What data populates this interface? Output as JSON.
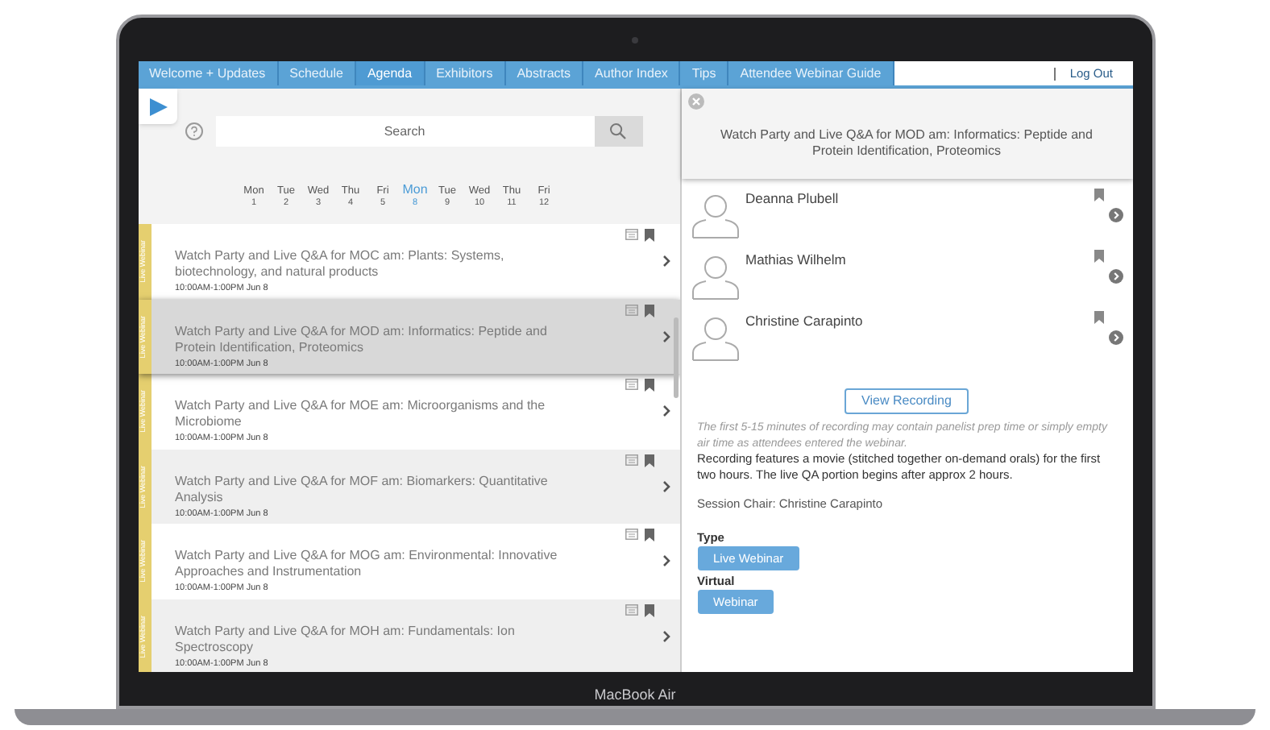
{
  "nav": {
    "tabs": [
      {
        "label": "Welcome + Updates",
        "selected": false
      },
      {
        "label": "Schedule",
        "selected": false
      },
      {
        "label": "Agenda",
        "selected": true
      },
      {
        "label": "Exhibitors",
        "selected": false
      },
      {
        "label": "Abstracts",
        "selected": false
      },
      {
        "label": "Author Index",
        "selected": false
      },
      {
        "label": "Tips",
        "selected": false
      },
      {
        "label": "Attendee Webinar Guide",
        "selected": false
      }
    ],
    "logout": "Log Out"
  },
  "search": {
    "placeholder": "Search"
  },
  "dates": [
    {
      "weekday": "Mon",
      "day": "1",
      "selected": false
    },
    {
      "weekday": "Tue",
      "day": "2",
      "selected": false
    },
    {
      "weekday": "Wed",
      "day": "3",
      "selected": false
    },
    {
      "weekday": "Thu",
      "day": "4",
      "selected": false
    },
    {
      "weekday": "Fri",
      "day": "5",
      "selected": false
    },
    {
      "weekday": "Mon",
      "day": "8",
      "selected": true
    },
    {
      "weekday": "Tue",
      "day": "9",
      "selected": false
    },
    {
      "weekday": "Wed",
      "day": "10",
      "selected": false
    },
    {
      "weekday": "Thu",
      "day": "11",
      "selected": false
    },
    {
      "weekday": "Fri",
      "day": "12",
      "selected": false
    }
  ],
  "sessions": [
    {
      "tag": "Live Webinar",
      "title": "Watch Party and Live Q&A for MOC am: Plants: Systems, biotechnology, and natural products",
      "time": "10:00AM-1:00PM Jun 8",
      "selected": false
    },
    {
      "tag": "Live Webinar",
      "title": "Watch Party and Live Q&A for MOD am: Informatics: Peptide and Protein Identification, Proteomics",
      "time": "10:00AM-1:00PM Jun 8",
      "selected": true
    },
    {
      "tag": "Live Webinar",
      "title": "Watch Party and Live Q&A for MOE am: Microorganisms and the Microbiome",
      "time": "10:00AM-1:00PM Jun 8",
      "selected": false
    },
    {
      "tag": "Live Webinar",
      "title": "Watch Party and Live Q&A for MOF am: Biomarkers: Quantitative Analysis",
      "time": "10:00AM-1:00PM Jun 8",
      "selected": false
    },
    {
      "tag": "Live Webinar",
      "title": "Watch Party and Live Q&A for MOG am: Environmental: Innovative Approaches and Instrumentation",
      "time": "10:00AM-1:00PM Jun 8",
      "selected": false
    },
    {
      "tag": "Live Webinar",
      "title": "Watch Party and Live Q&A for MOH am: Fundamentals: Ion Spectroscopy",
      "time": "10:00AM-1:00PM Jun 8",
      "selected": false
    }
  ],
  "detail": {
    "title": "Watch Party and Live Q&A for MOD am: Informatics: Peptide and Protein Identification, Proteomics",
    "speakers": [
      "Deanna Plubell",
      "Mathias Wilhelm",
      "Christine Carapinto"
    ],
    "recording_button": "View Recording",
    "note": "The first 5-15 minutes of recording may contain panelist prep time or simply empty air time as attendees entered the webinar.",
    "description": "Recording features a movie (stitched together on-demand orals) for the first two hours. The live QA portion begins after approx 2 hours.",
    "chair": "Session Chair: Christine Carapinto",
    "sections": [
      {
        "label": "Type",
        "tags": [
          "Live Webinar"
        ]
      },
      {
        "label": "Virtual",
        "tags": [
          "Webinar"
        ]
      }
    ]
  },
  "laptop_label": "MacBook Air"
}
